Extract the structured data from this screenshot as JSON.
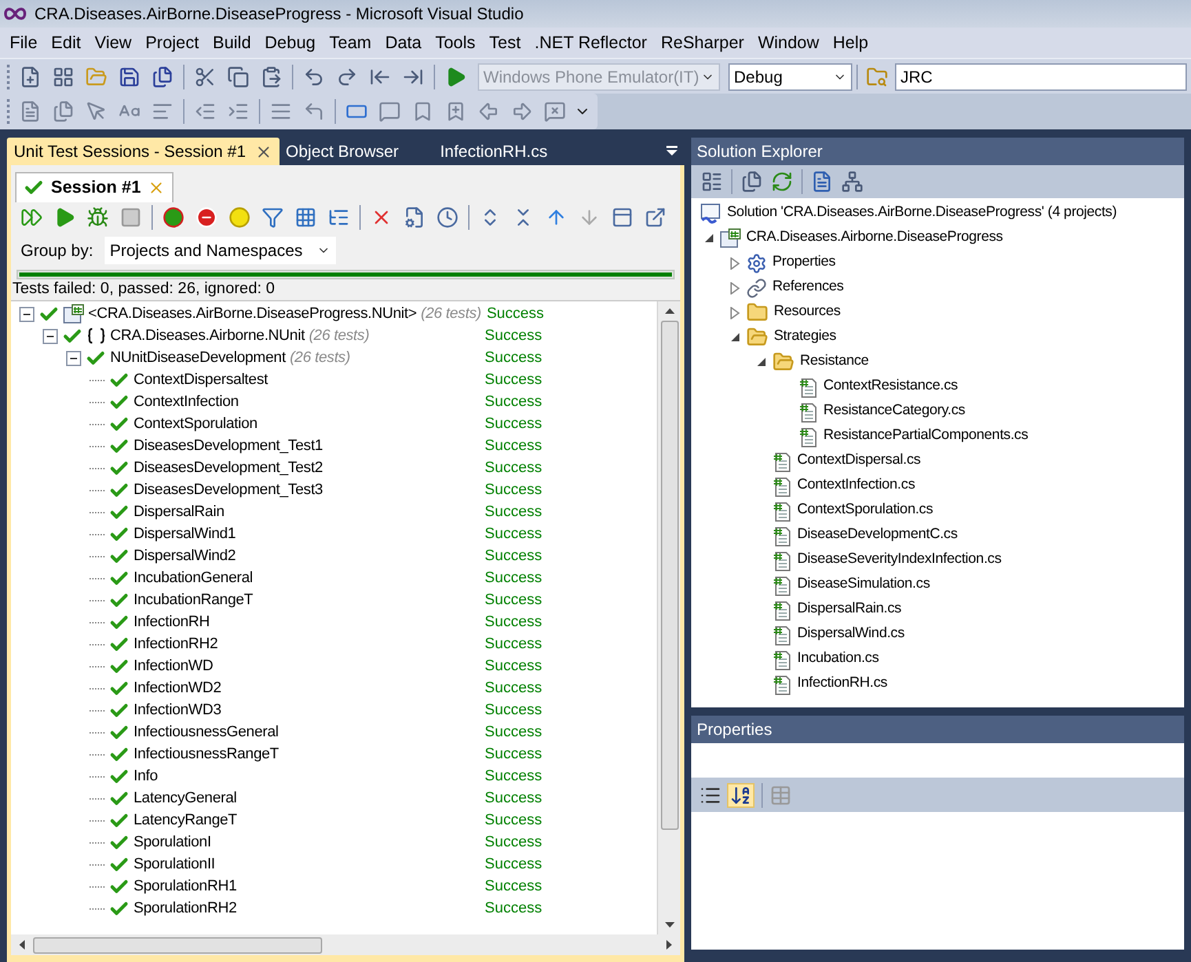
{
  "window": {
    "title": "CRA.Diseases.AirBorne.DiseaseProgress - Microsoft Visual Studio"
  },
  "menu": [
    "File",
    "Edit",
    "View",
    "Project",
    "Build",
    "Debug",
    "Team",
    "Data",
    "Tools",
    "Test",
    ".NET Reflector",
    "ReSharper",
    "Window",
    "Help"
  ],
  "toolbar": {
    "target": {
      "value": "Windows Phone Emulator(IT)",
      "disabled": true
    },
    "configuration": {
      "value": "Debug",
      "disabled": false
    },
    "find": {
      "value": "JRC"
    }
  },
  "left_panel": {
    "tabs": [
      {
        "label": "Unit Test Sessions - Session #1",
        "selected": true,
        "closable": true
      },
      {
        "label": "Object Browser",
        "selected": false,
        "closable": false
      },
      {
        "label": "InfectionRH.cs",
        "selected": false,
        "closable": false
      }
    ],
    "session_tab": {
      "label": "Session #1",
      "passed": true
    },
    "group_by": {
      "label": "Group by:",
      "value": "Projects and Namespaces"
    },
    "progress": {
      "level": 1
    },
    "summary": "Tests failed: 0, passed: 26, ignored: 0",
    "test_tree": [
      {
        "kind": "project",
        "name": "<CRA.Diseases.AirBorne.DiseaseProgress.NUnit>",
        "count": "(26 tests)",
        "passed": true,
        "result": "Success",
        "expanded": true,
        "children": [
          {
            "kind": "namespace",
            "name": "CRA.Diseases.Airborne.NUnit",
            "count": "(26 tests)",
            "passed": true,
            "result": "Success",
            "expanded": true,
            "children": [
              {
                "kind": "fixture",
                "name": "NUnitDiseaseDevelopment",
                "count": "(26 tests)",
                "passed": true,
                "result": "Success",
                "expanded": true,
                "children": [
                  {
                    "kind": "test",
                    "name": "ContextDispersaltest",
                    "passed": true,
                    "result": "Success"
                  },
                  {
                    "kind": "test",
                    "name": "ContextInfection",
                    "passed": true,
                    "result": "Success"
                  },
                  {
                    "kind": "test",
                    "name": "ContextSporulation",
                    "passed": true,
                    "result": "Success"
                  },
                  {
                    "kind": "test",
                    "name": "DiseasesDevelopment_Test1",
                    "passed": true,
                    "result": "Success"
                  },
                  {
                    "kind": "test",
                    "name": "DiseasesDevelopment_Test2",
                    "passed": true,
                    "result": "Success"
                  },
                  {
                    "kind": "test",
                    "name": "DiseasesDevelopment_Test3",
                    "passed": true,
                    "result": "Success"
                  },
                  {
                    "kind": "test",
                    "name": "DispersalRain",
                    "passed": true,
                    "result": "Success"
                  },
                  {
                    "kind": "test",
                    "name": "DispersalWind1",
                    "passed": true,
                    "result": "Success"
                  },
                  {
                    "kind": "test",
                    "name": "DispersalWind2",
                    "passed": true,
                    "result": "Success"
                  },
                  {
                    "kind": "test",
                    "name": "IncubationGeneral",
                    "passed": true,
                    "result": "Success"
                  },
                  {
                    "kind": "test",
                    "name": "IncubationRangeT",
                    "passed": true,
                    "result": "Success"
                  },
                  {
                    "kind": "test",
                    "name": "InfectionRH",
                    "passed": true,
                    "result": "Success"
                  },
                  {
                    "kind": "test",
                    "name": "InfectionRH2",
                    "passed": true,
                    "result": "Success"
                  },
                  {
                    "kind": "test",
                    "name": "InfectionWD",
                    "passed": true,
                    "result": "Success"
                  },
                  {
                    "kind": "test",
                    "name": "InfectionWD2",
                    "passed": true,
                    "result": "Success"
                  },
                  {
                    "kind": "test",
                    "name": "InfectionWD3",
                    "passed": true,
                    "result": "Success"
                  },
                  {
                    "kind": "test",
                    "name": "InfectiousnessGeneral",
                    "passed": true,
                    "result": "Success"
                  },
                  {
                    "kind": "test",
                    "name": "InfectiousnessRangeT",
                    "passed": true,
                    "result": "Success"
                  },
                  {
                    "kind": "test",
                    "name": "Info",
                    "passed": true,
                    "result": "Success"
                  },
                  {
                    "kind": "test",
                    "name": "LatencyGeneral",
                    "passed": true,
                    "result": "Success"
                  },
                  {
                    "kind": "test",
                    "name": "LatencyRangeT",
                    "passed": true,
                    "result": "Success"
                  },
                  {
                    "kind": "test",
                    "name": "SporulationI",
                    "passed": true,
                    "result": "Success"
                  },
                  {
                    "kind": "test",
                    "name": "SporulationII",
                    "passed": true,
                    "result": "Success"
                  },
                  {
                    "kind": "test",
                    "name": "SporulationRH1",
                    "passed": true,
                    "result": "Success"
                  },
                  {
                    "kind": "test",
                    "name": "SporulationRH2",
                    "passed": true,
                    "result": "Success"
                  }
                ]
              }
            ]
          }
        ]
      }
    ]
  },
  "solution_explorer": {
    "title": "Solution Explorer",
    "tree": [
      {
        "kind": "solution",
        "label": "Solution 'CRA.Diseases.AirBorne.DiseaseProgress' (4 projects)",
        "children": [
          {
            "kind": "project",
            "label": "CRA.Diseases.Airborne.DiseaseProgress",
            "expanded": true,
            "children": [
              {
                "kind": "properties",
                "label": "Properties",
                "expanded": false
              },
              {
                "kind": "references",
                "label": "References",
                "expanded": false
              },
              {
                "kind": "folder",
                "label": "Resources",
                "expanded": false
              },
              {
                "kind": "folder",
                "label": "Strategies",
                "expanded": true,
                "children": [
                  {
                    "kind": "folder",
                    "label": "Resistance",
                    "expanded": true,
                    "children": [
                      {
                        "kind": "file",
                        "label": "ContextResistance.cs"
                      },
                      {
                        "kind": "file",
                        "label": "ResistanceCategory.cs"
                      },
                      {
                        "kind": "file",
                        "label": "ResistancePartialComponents.cs"
                      }
                    ]
                  },
                  {
                    "kind": "file",
                    "label": "ContextDispersal.cs"
                  },
                  {
                    "kind": "file",
                    "label": "ContextInfection.cs"
                  },
                  {
                    "kind": "file",
                    "label": "ContextSporulation.cs"
                  },
                  {
                    "kind": "file",
                    "label": "DiseaseDevelopmentC.cs"
                  },
                  {
                    "kind": "file",
                    "label": "DiseaseSeverityIndexInfection.cs"
                  },
                  {
                    "kind": "file",
                    "label": "DiseaseSimulation.cs"
                  },
                  {
                    "kind": "file",
                    "label": "DispersalRain.cs"
                  },
                  {
                    "kind": "file",
                    "label": "DispersalWind.cs"
                  },
                  {
                    "kind": "file",
                    "label": "Incubation.cs"
                  },
                  {
                    "kind": "file",
                    "label": "InfectionRH.cs"
                  }
                ]
              }
            ]
          }
        ]
      }
    ]
  },
  "properties": {
    "title": "Properties"
  }
}
